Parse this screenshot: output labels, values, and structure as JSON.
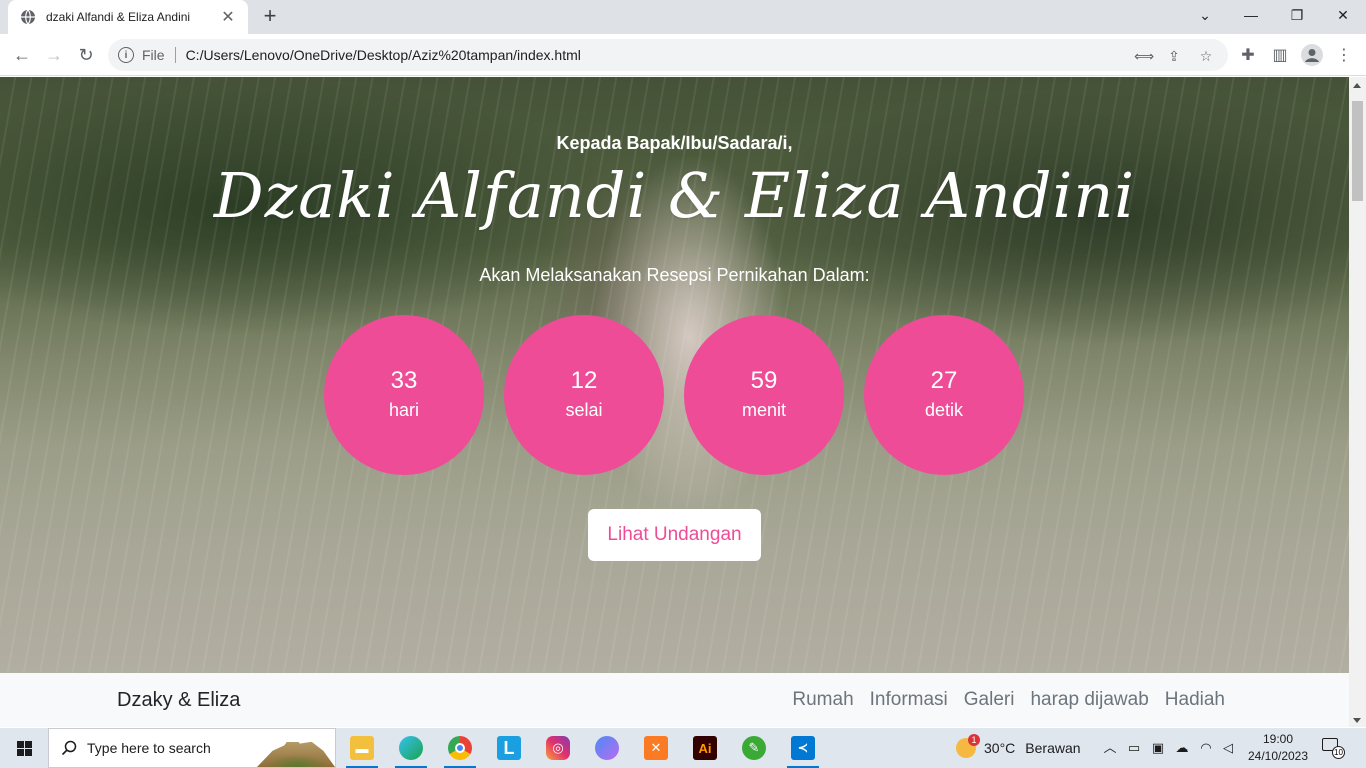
{
  "browser": {
    "tab_title": "dzaki Alfandi & Eliza Andini",
    "address_scheme": "File",
    "address_url": "C:/Users/Lenovo/OneDrive/Desktop/Aziz%20tampan/index.html"
  },
  "hero": {
    "greeting": "Kepada Bapak/Ibu/Sadara/i,",
    "couple_names": "Dzaki Alfandi & Eliza Andini",
    "subtitle": "Akan Melaksanakan Resepsi Pernikahan Dalam:",
    "countdown": [
      {
        "value": "33",
        "unit": "hari"
      },
      {
        "value": "12",
        "unit": "selai"
      },
      {
        "value": "59",
        "unit": "menit"
      },
      {
        "value": "27",
        "unit": "detik"
      }
    ],
    "cta_label": "Lihat Undangan"
  },
  "navbar": {
    "brand": "Dzaky & Eliza",
    "links": [
      "Rumah",
      "Informasi",
      "Galeri",
      "harap dijawab",
      "Hadiah"
    ]
  },
  "taskbar": {
    "search_placeholder": "Type here to search",
    "weather_badge": "1",
    "temperature": "30°C",
    "condition": "Berawan",
    "time": "19:00",
    "date": "24/10/2023",
    "notification_count": "10"
  },
  "colors": {
    "accent_pink": "#ee4c97",
    "navbar_bg": "#f8f9fa"
  },
  "icons": {
    "tab": "globe-icon",
    "navigation": [
      "back-arrow-icon",
      "forward-arrow-icon",
      "reload-icon"
    ],
    "omnibox": [
      "info-icon",
      "translate-icon",
      "share-icon",
      "star-icon"
    ],
    "toolbar": [
      "extensions-icon",
      "side-panel-icon",
      "profile-icon",
      "menu-icon"
    ]
  }
}
